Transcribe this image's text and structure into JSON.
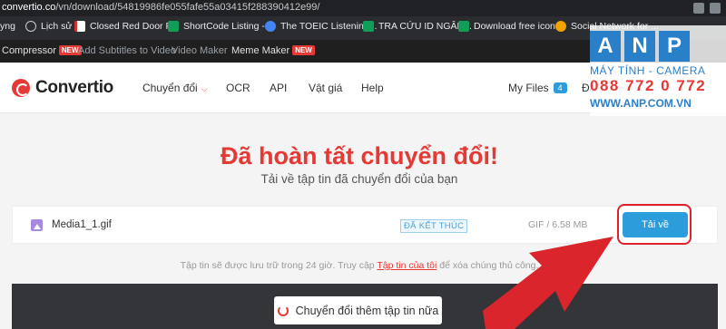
{
  "browser": {
    "url_host": "convertio.co",
    "url_path": "/vn/download/54819986fe055fafe55a03415f288390412e99/",
    "bookmarks": [
      {
        "label": "yng",
        "color": "#444"
      },
      {
        "label": "Lịch sử",
        "color": "#5f6368"
      },
      {
        "label": "Closed Red Door P...",
        "color": "#f6f6f6"
      },
      {
        "label": "ShortCode Listing -...",
        "color": "#0f9d58"
      },
      {
        "label": "The TOEIC Listening...",
        "color": "#4285f4"
      },
      {
        "label": "TRA CỨU ID NGÂN...",
        "color": "#0f9d58"
      },
      {
        "label": "Download free icon...",
        "color": "#0f9d58"
      },
      {
        "label": "Social Network for ...",
        "color": "#f4a300"
      }
    ]
  },
  "toolbar": {
    "compressor": "Compressor",
    "new_badge": "NEW",
    "add_subtitles": "Add Subtitles to Video",
    "video_maker": "Video Maker",
    "meme_maker": "Meme Maker"
  },
  "nav": {
    "logo": "Convertio",
    "convert": "Chuyển đổi",
    "ocr": "OCR",
    "api": "API",
    "pricing": "Vật giá",
    "help": "Help",
    "my_files": "My Files",
    "my_files_count": "4",
    "login_partial": "Đă"
  },
  "watermark": {
    "letters": [
      "A",
      "N",
      "P"
    ],
    "line1": "MÁY TÍNH - CAMERA",
    "line2": "088 772 0 772",
    "line3": "WWW.ANP.COM.VN"
  },
  "main": {
    "title": "Đã hoàn tất chuyển đổi!",
    "subtitle": "Tải về tập tin đã chuyển đổi của bạn",
    "file": {
      "name": "Media1_1.gif",
      "status": "ĐÃ KẾT THÚC",
      "size": "GIF / 6.58 MB",
      "download_label": "Tải về"
    },
    "note_before": "Tập tin sẽ được lưu trữ trong 24 giờ. Truy cập ",
    "note_link": "Tập tin của tôi",
    "note_after": " để xóa chúng thủ công.",
    "convert_more": "Chuyển đổi thêm tập tin nữa"
  },
  "colors": {
    "accent_red": "#e53935",
    "button_blue": "#2d9cdb",
    "arrow_red": "#d9252b"
  }
}
